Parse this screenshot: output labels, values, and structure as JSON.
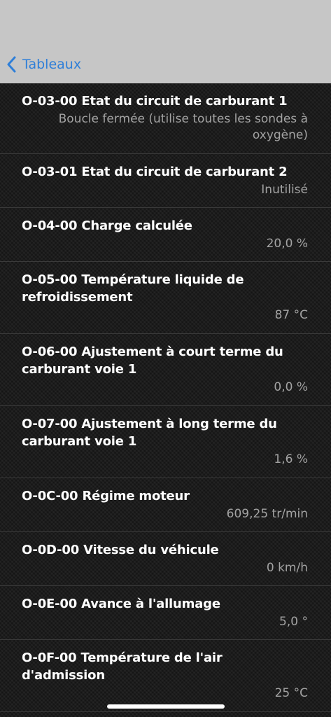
{
  "nav": {
    "back_label": "Tableaux",
    "back_icon": "chevron-left-icon",
    "accent": "#2f7fd8"
  },
  "items": [
    {
      "title": "O-03-00 Etat du circuit de carburant 1",
      "value": "Boucle fermée (utilise toutes les sondes à oxygène)"
    },
    {
      "title": "O-03-01 Etat du circuit de carburant 2",
      "value": "Inutilisé"
    },
    {
      "title": "O-04-00 Charge calculée",
      "value": "20,0 %"
    },
    {
      "title": "O-05-00 Température liquide de refroidissement",
      "value": "87 °C"
    },
    {
      "title": "O-06-00 Ajustement à court terme du carburant voie 1",
      "value": "0,0 %"
    },
    {
      "title": "O-07-00 Ajustement à long terme du carburant voie 1",
      "value": "1,6 %"
    },
    {
      "title": "O-0C-00 Régime moteur",
      "value": "609,25 tr/min"
    },
    {
      "title": "O-0D-00 Vitesse du véhicule",
      "value": "0 km/h"
    },
    {
      "title": "O-0E-00 Avance à l'allumage",
      "value": "5,0 °"
    },
    {
      "title": "O-0F-00 Température de l'air d'admission",
      "value": "25 °C"
    }
  ]
}
